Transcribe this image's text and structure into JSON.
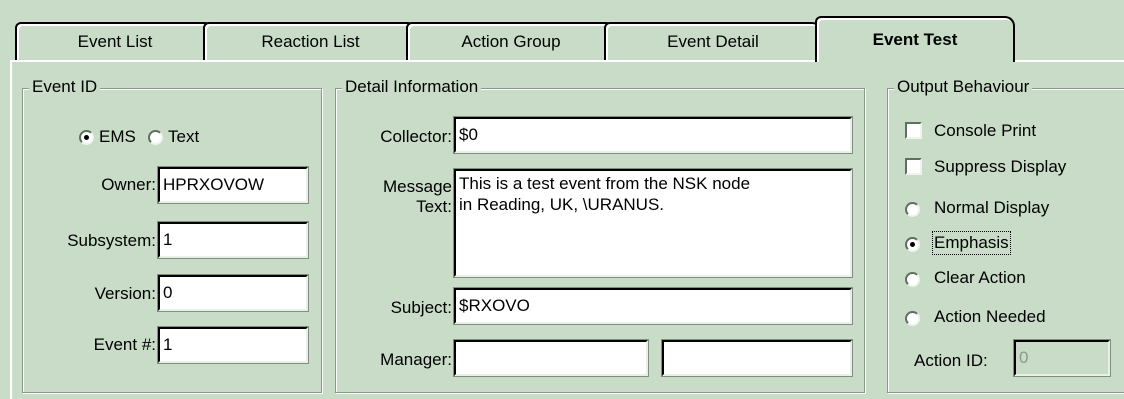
{
  "tabs": [
    {
      "label": "Event List"
    },
    {
      "label": "Reaction List"
    },
    {
      "label": "Action Group"
    },
    {
      "label": "Event Detail"
    },
    {
      "label": "Event Test"
    }
  ],
  "active_tab": "Event Test",
  "event_id": {
    "title": "Event ID",
    "type_options": [
      "EMS",
      "Text"
    ],
    "selected_type": "EMS",
    "owner_label": "Owner:",
    "owner_value": "HPRXOVOW",
    "subsystem_label": "Subsystem:",
    "subsystem_value": "1",
    "version_label": "Version:",
    "version_value": "0",
    "event_num_label": "Event #:",
    "event_num_value": "1"
  },
  "detail": {
    "title": "Detail Information",
    "collector_label": "Collector:",
    "collector_value": "$0",
    "message_label_1": "Message",
    "message_label_2": "Text:",
    "message_value": "This is a test event from the NSK node\nin Reading, UK, \\URANUS.",
    "subject_label": "Subject:",
    "subject_value": "$RXOVO",
    "manager_label": "Manager:",
    "manager_value_1": "",
    "manager_value_2": ""
  },
  "output": {
    "title": "Output Behaviour",
    "checkboxes": [
      "Console Print",
      "Suppress Display"
    ],
    "radios": [
      "Normal Display",
      "Emphasis",
      "Clear Action",
      "Action Needed"
    ],
    "selected_radio": "Emphasis",
    "action_id_label": "Action ID:",
    "action_id_value": "0"
  }
}
